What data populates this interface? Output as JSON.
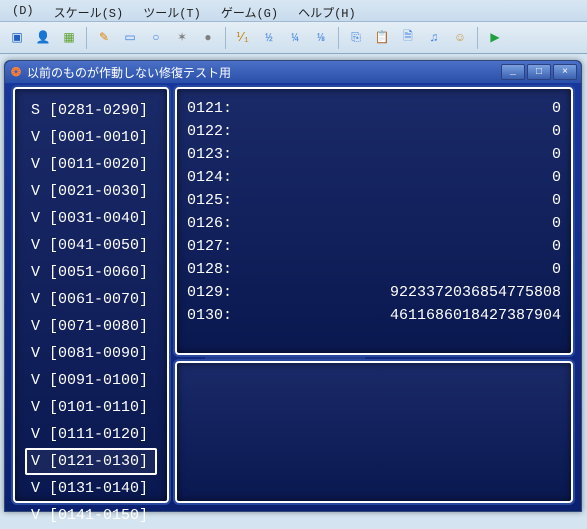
{
  "menu": {
    "items": [
      "(D)",
      "スケール(S)",
      "ツール(T)",
      "ゲーム(G)",
      "ヘルプ(H)"
    ]
  },
  "toolbar": {
    "icons": [
      {
        "name": "layers-icon",
        "glyph": "▣",
        "color": "#2060c0"
      },
      {
        "name": "person-icon",
        "glyph": "👤",
        "color": "#d07000"
      },
      {
        "name": "picture-icon",
        "glyph": "▦",
        "color": "#60a030"
      },
      {
        "name": "sep"
      },
      {
        "name": "pencil-icon",
        "glyph": "✎",
        "color": "#e08000"
      },
      {
        "name": "rect-icon",
        "glyph": "▭",
        "color": "#4080e0"
      },
      {
        "name": "circle-icon",
        "glyph": "○",
        "color": "#4080e0"
      },
      {
        "name": "star-icon",
        "glyph": "✶",
        "color": "#808080"
      },
      {
        "name": "dot-icon",
        "glyph": "●",
        "color": "#808080"
      },
      {
        "name": "sep"
      },
      {
        "name": "scale-11-icon",
        "glyph": "⅟₁",
        "color": "#c08000"
      },
      {
        "name": "scale-12-icon",
        "glyph": "½",
        "color": "#4080e0"
      },
      {
        "name": "scale-14-icon",
        "glyph": "¼",
        "color": "#4080e0"
      },
      {
        "name": "scale-18-icon",
        "glyph": "⅛",
        "color": "#4080e0"
      },
      {
        "name": "sep"
      },
      {
        "name": "copy-icon",
        "glyph": "⎘",
        "color": "#4080e0"
      },
      {
        "name": "paste-icon",
        "glyph": "📋",
        "color": "#4080e0"
      },
      {
        "name": "doc-icon",
        "glyph": "🗎",
        "color": "#4080e0"
      },
      {
        "name": "music-icon",
        "glyph": "♫",
        "color": "#4080e0"
      },
      {
        "name": "avatar-icon",
        "glyph": "☺",
        "color": "#c08000"
      },
      {
        "name": "sep"
      },
      {
        "name": "play-icon",
        "glyph": "▶",
        "color": "#20a040"
      }
    ]
  },
  "subwindow": {
    "title": "以前のものが作動しない修復テスト用",
    "min": "_",
    "max": "□",
    "close": "×"
  },
  "leftList": [
    {
      "label": "S [0281-0290]",
      "sel": false
    },
    {
      "label": "V [0001-0010]",
      "sel": false
    },
    {
      "label": "V [0011-0020]",
      "sel": false
    },
    {
      "label": "V [0021-0030]",
      "sel": false
    },
    {
      "label": "V [0031-0040]",
      "sel": false
    },
    {
      "label": "V [0041-0050]",
      "sel": false
    },
    {
      "label": "V [0051-0060]",
      "sel": false
    },
    {
      "label": "V [0061-0070]",
      "sel": false
    },
    {
      "label": "V [0071-0080]",
      "sel": false
    },
    {
      "label": "V [0081-0090]",
      "sel": false
    },
    {
      "label": "V [0091-0100]",
      "sel": false
    },
    {
      "label": "V [0101-0110]",
      "sel": false
    },
    {
      "label": "V [0111-0120]",
      "sel": false
    },
    {
      "label": "V [0121-0130]",
      "sel": true
    },
    {
      "label": "V [0131-0140]",
      "sel": false
    },
    {
      "label": "V [0141-0150]",
      "sel": false
    }
  ],
  "vars": [
    {
      "id": "0121:",
      "val": "0"
    },
    {
      "id": "0122:",
      "val": "0"
    },
    {
      "id": "0123:",
      "val": "0"
    },
    {
      "id": "0124:",
      "val": "0"
    },
    {
      "id": "0125:",
      "val": "0"
    },
    {
      "id": "0126:",
      "val": "0"
    },
    {
      "id": "0127:",
      "val": "0"
    },
    {
      "id": "0128:",
      "val": "0"
    },
    {
      "id": "0129:",
      "val": "9223372036854775808"
    },
    {
      "id": "0130:",
      "val": "4611686018427387904"
    }
  ]
}
